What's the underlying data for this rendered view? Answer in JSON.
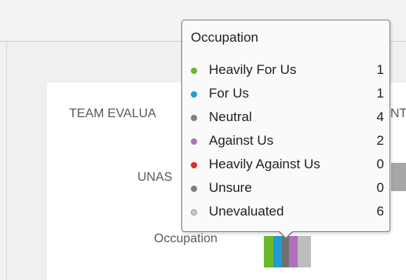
{
  "rows": {
    "team_evaluation": "TEAM EVALUA",
    "team_evaluation_right": "NT",
    "unassigned": "UNAS",
    "occupation": "Occupation"
  },
  "occupation_bar": {
    "segments": [
      {
        "name": "Heavily For Us",
        "count": 1,
        "color": "#6aba2a"
      },
      {
        "name": "For Us",
        "count": 1,
        "color": "#1f9bd7"
      },
      {
        "name": "Neutral",
        "count": 4,
        "color": "#707070"
      },
      {
        "name": "Against Us",
        "count": 2,
        "color": "#b06fbd"
      },
      {
        "name": "Unevaluated",
        "count": 6,
        "color": "#bdbdbd"
      }
    ]
  },
  "tooltip": {
    "title": "Occupation",
    "items": [
      {
        "label": "Heavily For Us",
        "count": "1",
        "color": "#6aba2a"
      },
      {
        "label": "For Us",
        "count": "1",
        "color": "#1f9bd7"
      },
      {
        "label": "Neutral",
        "count": "4",
        "color": "#808080"
      },
      {
        "label": "Against Us",
        "count": "2",
        "color": "#b06fbd"
      },
      {
        "label": "Heavily Against Us",
        "count": "0",
        "color": "#e02a2a"
      },
      {
        "label": "Unsure",
        "count": "0",
        "color": "#808080"
      },
      {
        "label": "Unevaluated",
        "count": "6",
        "color": "#c8c8c8"
      }
    ]
  }
}
